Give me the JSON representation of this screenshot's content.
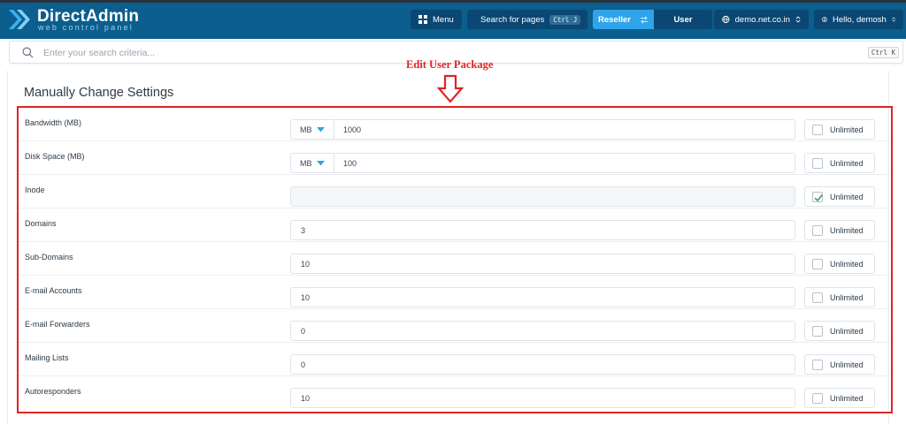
{
  "header": {
    "logo_title": "DirectAdmin",
    "logo_subtitle": "web control panel",
    "menu_label": "Menu",
    "search_pages_label": "Search for pages",
    "search_pages_shortcut": "Ctrl J",
    "role_active": "Reseller",
    "role_other": "User",
    "domain": "demo.net.co.in",
    "greeting": "Hello, demosh",
    "icons": {
      "logo": "directadmin-chevron-logo",
      "menu": "grid-icon",
      "search": "search-icon",
      "switch": "swap-arrows-icon",
      "domain": "globe-icon",
      "user": "user-circle-icon",
      "select": "updown-chevron-icon"
    }
  },
  "search": {
    "placeholder": "Enter your search criteria...",
    "shortcut": "Ctrl K"
  },
  "annotation": {
    "label": "Edit User Package",
    "color": "#e02424"
  },
  "section": {
    "title": "Manually Change Settings"
  },
  "settings": {
    "unlimited_label": "Unlimited",
    "rows": [
      {
        "label": "Bandwidth (MB)",
        "unit": "MB",
        "value": "1000",
        "unlimited": false,
        "disabled": false
      },
      {
        "label": "Disk Space (MB)",
        "unit": "MB",
        "value": "100",
        "unlimited": false,
        "disabled": false
      },
      {
        "label": "Inode",
        "unit": "",
        "value": "",
        "unlimited": true,
        "disabled": true
      },
      {
        "label": "Domains",
        "unit": "",
        "value": "3",
        "unlimited": false,
        "disabled": false
      },
      {
        "label": "Sub-Domains",
        "unit": "",
        "value": "10",
        "unlimited": false,
        "disabled": false
      },
      {
        "label": "E-mail Accounts",
        "unit": "",
        "value": "10",
        "unlimited": false,
        "disabled": false
      },
      {
        "label": "E-mail Forwarders",
        "unit": "",
        "value": "0",
        "unlimited": false,
        "disabled": false
      },
      {
        "label": "Mailing Lists",
        "unit": "",
        "value": "0",
        "unlimited": false,
        "disabled": false
      },
      {
        "label": "Autoresponders",
        "unit": "",
        "value": "10",
        "unlimited": false,
        "disabled": false
      }
    ]
  },
  "colors": {
    "header_bg": "#0b5e8e",
    "header_button_bg": "#0a4772",
    "accent": "#30a4ea",
    "checkbox_check": "#3a9b6b"
  }
}
